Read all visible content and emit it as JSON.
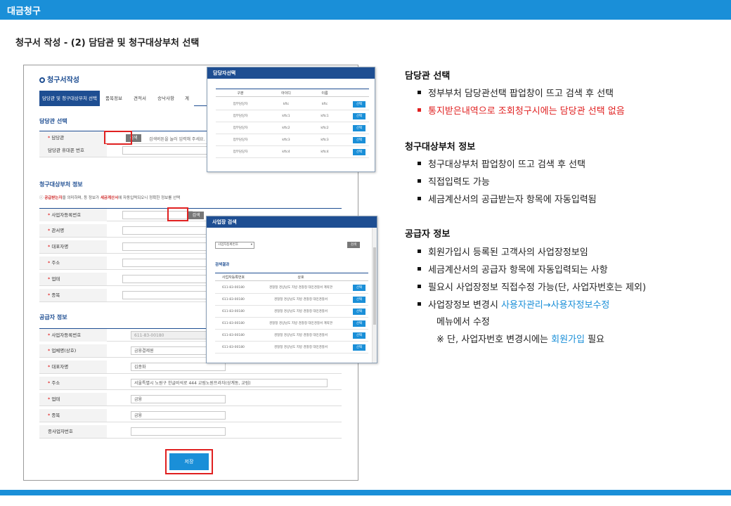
{
  "header": {
    "title": "대금청구"
  },
  "page": {
    "title": "청구서 작성 - (2) 담담관 및 청구대상부처 선택"
  },
  "form": {
    "title": "청구서작성",
    "tabs": [
      "담당관 및 청구대상부처 선택",
      "품목정보",
      "견적서",
      "승낙사항",
      "계"
    ],
    "officer_section": "담당관 선택",
    "officer_label": "담당관",
    "officer_search_btn": "검색",
    "officer_hint": "검색버튼을 눌러 입력해 주세요.",
    "officer_phone_label": "담당관 휴대폰 번호",
    "dept_section": "청구대상부처 정보",
    "dept_notice_bold": "공급받는자",
    "dept_notice_mid": "을 의미하며, 등 정보가 ",
    "dept_notice_bold2": "세금계산서",
    "dept_notice_end": "에 자동입력되오니 정확한 정보를 선택",
    "dept_fields": [
      "사업자등록번호",
      "관서명",
      "대표자명",
      "주소",
      "업태",
      "종목"
    ],
    "dept_search_btn": "검색",
    "supplier_section": "공급자 정보",
    "supplier_fields": [
      {
        "label": "사업자등록번호",
        "value": "611-83-00180"
      },
      {
        "label": "업체명(상호)",
        "value": "금융결제원"
      },
      {
        "label": "대표자명",
        "value": "김종화"
      },
      {
        "label": "주소",
        "value": "서울특별시 노원구 한글비석로 444 교림노원프라자(상계동, 교림)"
      },
      {
        "label": "업태",
        "value": "금융"
      },
      {
        "label": "종목",
        "value": "금융"
      },
      {
        "label": "종사업자번호",
        "value": ""
      }
    ],
    "save_btn": "저장"
  },
  "popup_officer": {
    "title": "담당자선택",
    "headers": [
      "구분",
      "아이디",
      "이름"
    ],
    "rows": [
      {
        "type": "업무담당자",
        "id": "kftc",
        "name": "kftc",
        "btn": "선택"
      },
      {
        "type": "업무담당자",
        "id": "kftc1",
        "name": "kftc1",
        "btn": "선택"
      },
      {
        "type": "업무담당자",
        "id": "kftc2",
        "name": "kftc2",
        "btn": "선택"
      },
      {
        "type": "업무담당자",
        "id": "kftc3",
        "name": "kftc3",
        "btn": "선택"
      },
      {
        "type": "업무담당자",
        "id": "kftc4",
        "name": "kftc4",
        "btn": "선택"
      }
    ]
  },
  "popup_business": {
    "title": "사업장 검색",
    "select_value": "사업자등록번호",
    "search_btn": "검색",
    "result_label": "검색결과",
    "headers": [
      "사업자등록번호",
      "상호"
    ],
    "rows": [
      {
        "no": "611-83-00180",
        "name": "경찰청 경상남도 지방 경찰청 대민경찰서 계약관",
        "btn": "선택"
      },
      {
        "no": "611-83-00180",
        "name": "경찰청 경상남도 지방 경찰청 대민경찰서",
        "btn": "선택"
      },
      {
        "no": "611-83-00180",
        "name": "경찰청 경상남도 지방 경찰청 대민경찰서",
        "btn": "선택"
      },
      {
        "no": "611-83-00180",
        "name": "경찰청 경상남도 지방 경찰청 대민경찰서 계약관",
        "btn": "선택"
      },
      {
        "no": "611-83-00180",
        "name": "경찰청 경상남도 지방 경찰청 대민경찰서",
        "btn": "선택"
      },
      {
        "no": "611-83-00180",
        "name": "경찰청 경상남도 지방 경찰청 대민경찰서",
        "btn": "선택"
      }
    ]
  },
  "explain": {
    "officer": {
      "heading": "담당관 선택",
      "b1": "정부부처 담당관선택 팝업창이 뜨고 검색 후 선택",
      "b2": "통지받은내역으로 조회청구시에는 담당관 선택 없음"
    },
    "dept": {
      "heading": "청구대상부처 정보",
      "b1": "청구대상부처 팝업창이 뜨고 검색 후 선택",
      "b2": "직접입력도 가능",
      "b3": "세금계산서의 공급받는자 항목에 자동입력됨"
    },
    "supplier": {
      "heading": "공급자 정보",
      "b1": "회원가입시 등록된 고객사의 사업장정보임",
      "b2": "세금계산서의 공급자 항목에 자동입력되는 사항",
      "b3": "필요시 사업장정보 직접수정 가능(단, 사업자번호는 제외)",
      "b4_pre": "사업장정보 변경시 ",
      "b4_link": "사용자관리→사용자정보수정",
      "b4_cont": "메뉴에서  수정",
      "note_pre": "※ 단, 사업자번호 변경시에는 ",
      "note_link": "회원가입",
      "note_post": " 필요"
    }
  }
}
